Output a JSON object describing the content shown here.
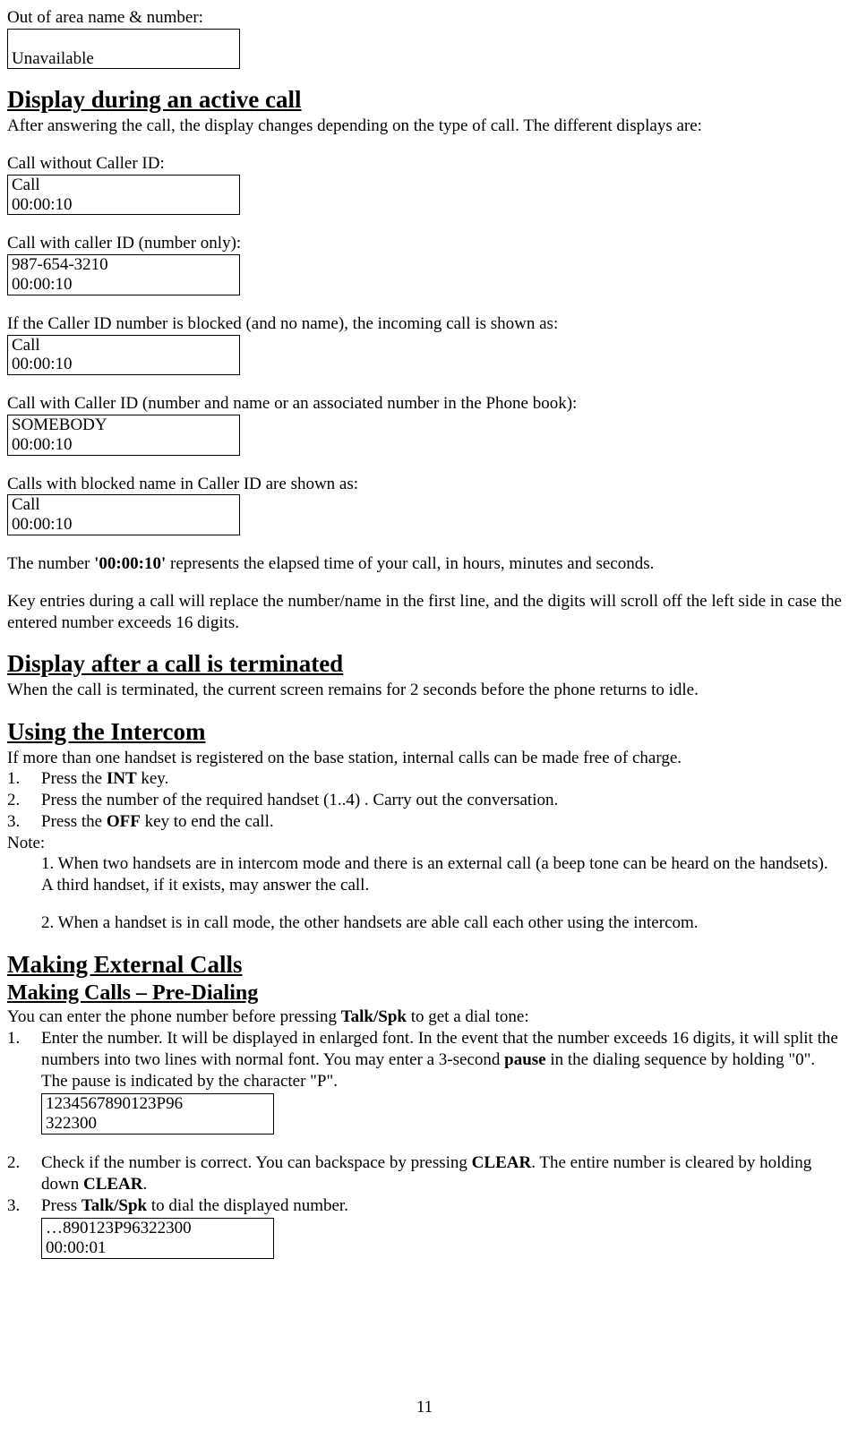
{
  "intro_label": "Out of area name & number:",
  "box_unavailable_l1": "",
  "box_unavailable_l2": "Unavailable",
  "h_active": "Display during an active call",
  "p_active": "After answering the call, the display changes depending on the type of call. The different displays are:",
  "lbl_nocid": "Call without Caller ID:",
  "box_nocid_l1": "Call",
  "box_nocid_l2": "00:00:10",
  "lbl_numonly": "Call with caller ID (number only):",
  "box_numonly_l1": "987-654-3210",
  "box_numonly_l2": "00:00:10",
  "lbl_blocked_num": "If the Caller ID number is blocked (and no name), the incoming call is shown as:",
  "box_blocked_num_l1": "Call",
  "box_blocked_num_l2": "00:00:10",
  "lbl_name_num": "Call with Caller ID (number and name or an associated number in the Phone book):",
  "box_name_num_l1": "SOMEBODY",
  "box_name_num_l2": "00:00:10",
  "lbl_blocked_name": "Calls with blocked name in Caller ID are shown as:",
  "box_blocked_name_l1": "Call",
  "box_blocked_name_l2": "00:00:10",
  "p_elapsed_pre": "The number ",
  "p_elapsed_bold": "'00:00:10'",
  "p_elapsed_post": " represents the elapsed time of your call, in hours, minutes and seconds.",
  "p_keyentries": "Key entries during a call will replace the number/name in the first line, and the digits will scroll off the left side in case the entered number exceeds 16 digits.",
  "h_terminated": "Display after a call is terminated",
  "p_terminated": "When the call is terminated, the current screen remains for 2 seconds before the phone returns to idle.",
  "h_intercom": "Using the Intercom",
  "p_intercom_intro": "If more than one handset is registered on the base station, internal calls can be made free of charge.",
  "int_li1_num": "1.",
  "int_li1_a": "Press the ",
  "int_li1_bold": "INT",
  "int_li1_b": " key.",
  "int_li2_num": "2.",
  "int_li2": "Press the number of the required handset (1..4) . Carry out the conversation.",
  "int_li3_num": "3.",
  "int_li3_a": "Press the ",
  "int_li3_bold": "OFF",
  "int_li3_b": " key to end the call.",
  "note_label": "Note:",
  "note1": "1. When two handsets are in intercom mode and there is an external call (a beep tone can be heard on the handsets).  A third handset, if it exists, may answer the call.",
  "note2": "2. When a handset is in call mode, the other handsets are able call each other using the intercom.",
  "h_external": "Making External Calls",
  "h_predial": "Making Calls – Pre-Dialing",
  "p_predial_a": "You can enter the phone number before pressing ",
  "p_predial_bold": "Talk/Spk",
  "p_predial_b": " to get a dial tone:",
  "ext_li1_num": "1.",
  "ext_li1_a": "Enter the number.  It will be displayed in enlarged font.  In the event that the number exceeds 16 digits, it will split the numbers into two lines with normal font. You may enter a 3-second ",
  "ext_li1_bold": "pause",
  "ext_li1_b": " in the dialing sequence by holding \"0\".  The pause is indicated by the character \"P\".",
  "box_pre_l1": "1234567890123P96",
  "box_pre_l2": "322300",
  "ext_li2_num": "2.",
  "ext_li2_a": "Check if the number is correct. You can backspace by pressing ",
  "ext_li2_bold1": "CLEAR",
  "ext_li2_b": ". The entire number is cleared by holding down ",
  "ext_li2_bold2": "CLEAR",
  "ext_li2_c": ".",
  "ext_li3_num": "3.",
  "ext_li3_a": "Press ",
  "ext_li3_bold": "Talk/Spk",
  "ext_li3_b": " to dial the displayed number.",
  "box_dial_l1": "…890123P96322300",
  "box_dial_l2": "00:00:01",
  "page_num": "11"
}
